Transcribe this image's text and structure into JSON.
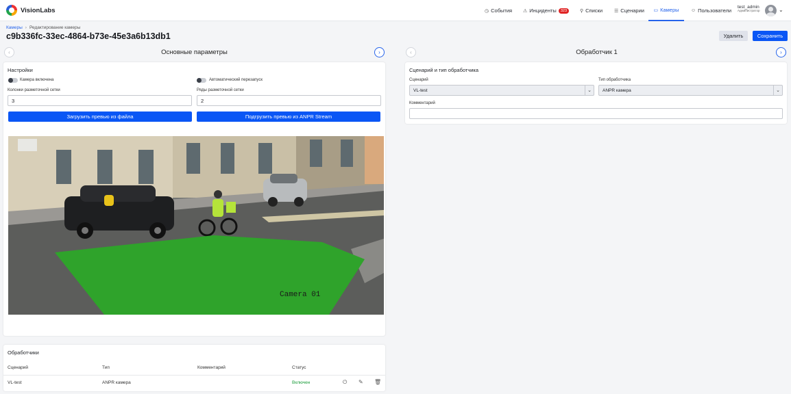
{
  "header": {
    "brand": "VisionLabs",
    "nav": [
      {
        "label": "События",
        "icon": "clock-icon"
      },
      {
        "label": "Инциденты",
        "icon": "warning-icon",
        "badge": "323"
      },
      {
        "label": "Списки",
        "icon": "pin-icon"
      },
      {
        "label": "Сценарии",
        "icon": "list-icon"
      },
      {
        "label": "Камеры",
        "icon": "camera-icon",
        "active": true
      },
      {
        "label": "Пользователи",
        "icon": "user-icon"
      }
    ],
    "user_name": "test_admin",
    "user_role": "Администратор"
  },
  "breadcrumb": {
    "root": "Камеры",
    "current": "Редактирование камеры"
  },
  "page_title": "c9b336fc-33ec-4864-b73e-45e3a6b13db1",
  "actions": {
    "delete": "Удалить",
    "save": "Сохранить"
  },
  "left": {
    "section_title": "Основные параметры",
    "settings": {
      "title": "Настройки",
      "camera_enabled_label": "Камера включена",
      "auto_restart_label": "Автоматический перезапуск",
      "grid_cols_label": "Колонки разметочной сетки",
      "grid_cols_value": "3",
      "grid_rows_label": "Ряды разметочной сетки",
      "grid_rows_value": "2",
      "upload_file_button": "Загрузить превью из файла",
      "load_stream_button": "Подгрузить превью из ANPR Stream",
      "preview_caption": "Camera 01"
    },
    "handlers": {
      "title": "Обработчики",
      "columns": [
        "Сценарий",
        "Тип",
        "Комментарий",
        "Статус"
      ],
      "rows": [
        {
          "scenario": "VL-test",
          "type": "ANPR камера",
          "comment": "",
          "status": "Включен"
        }
      ]
    }
  },
  "right": {
    "section_title": "Обработчик 1",
    "card_title": "Сценарий и тип обработчика",
    "scenario_label": "Сценарий",
    "scenario_value": "VL-test",
    "type_label": "Тип обработчика",
    "type_value": "ANPR камера",
    "comment_label": "Комментарий",
    "comment_value": ""
  },
  "colors": {
    "accent": "#0a56f5",
    "status_on": "#1a9c3a",
    "zone": "#2fa32b"
  }
}
